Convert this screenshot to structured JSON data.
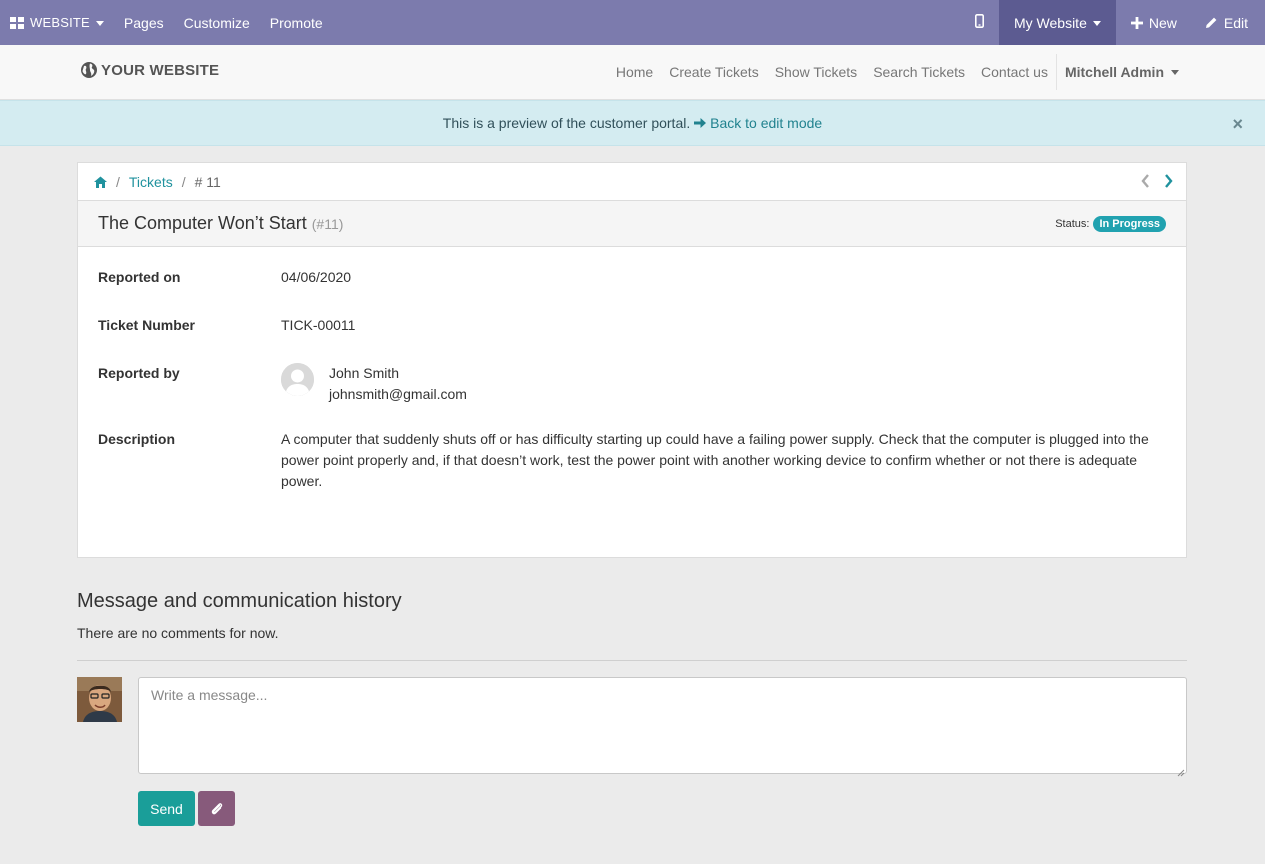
{
  "adminbar": {
    "brand": "WEBSITE",
    "menu": [
      "Pages",
      "Customize",
      "Promote"
    ],
    "website_switcher": "My Website",
    "new_label": "New",
    "edit_label": "Edit",
    "icons": [
      "apps-grid-icon",
      "mobile-icon",
      "plus-icon",
      "pencil-icon"
    ]
  },
  "header": {
    "logo_text": "YOUR WEBSITE",
    "nav": [
      "Home",
      "Create Tickets",
      "Show Tickets",
      "Search Tickets",
      "Contact us"
    ],
    "user": "Mitchell Admin"
  },
  "alert": {
    "text": "This is a preview of the customer portal.",
    "link": "Back to edit mode",
    "close": "×"
  },
  "breadcrumb": {
    "section": "Tickets",
    "current": "# 11",
    "separator": "/"
  },
  "ticket": {
    "title": "The Computer Won’t Start",
    "ref": "(#11)",
    "status_label": "Status:",
    "status": "In Progress",
    "fields": {
      "reported_on_label": "Reported on",
      "reported_on": "04/06/2020",
      "ticket_number_label": "Ticket Number",
      "ticket_number": "TICK-00011",
      "reported_by_label": "Reported by",
      "reporter_name": "John Smith",
      "reporter_email": "johnsmith@gmail.com",
      "description_label": "Description",
      "description": "A computer that suddenly shuts off or has difficulty starting up could have a failing power supply. Check that the computer is plugged into the power point properly and, if that doesn’t work, test the power point with another working device to confirm whether or not there is adequate power."
    }
  },
  "messages": {
    "title": "Message and communication history",
    "empty": "There are no comments for now.",
    "placeholder": "Write a message...",
    "send_label": "Send"
  },
  "colors": {
    "admin_bar": "#7c7bad",
    "accent_teal": "#21a2b0",
    "send_button": "#1a9e99",
    "attach_button": "#875a7b"
  }
}
